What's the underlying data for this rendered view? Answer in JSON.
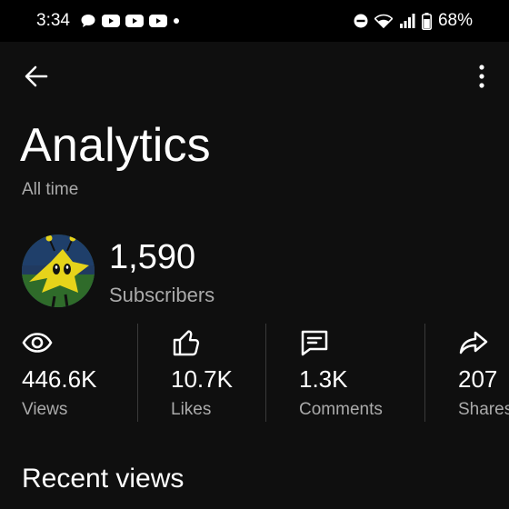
{
  "status_bar": {
    "time": "3:34",
    "notification_icons": [
      "chat-bubble-icon",
      "youtube-icon",
      "youtube-icon",
      "youtube-icon",
      "dot-icon"
    ],
    "battery": "68%"
  },
  "header": {
    "title": "Analytics",
    "subtitle": "All time"
  },
  "channel": {
    "subscriber_count": "1,590",
    "subscriber_label": "Subscribers"
  },
  "stats": [
    {
      "icon": "eye-icon",
      "value": "446.6K",
      "label": "Views"
    },
    {
      "icon": "thumbs-up-icon",
      "value": "10.7K",
      "label": "Likes"
    },
    {
      "icon": "comment-icon",
      "value": "1.3K",
      "label": "Comments"
    },
    {
      "icon": "share-icon",
      "value": "207",
      "label": "Shares"
    }
  ],
  "sections": {
    "recent_views": "Recent views"
  },
  "colors": {
    "background": "#0f0f0f",
    "text": "#ffffff",
    "secondary_text": "#aaaaaa"
  }
}
